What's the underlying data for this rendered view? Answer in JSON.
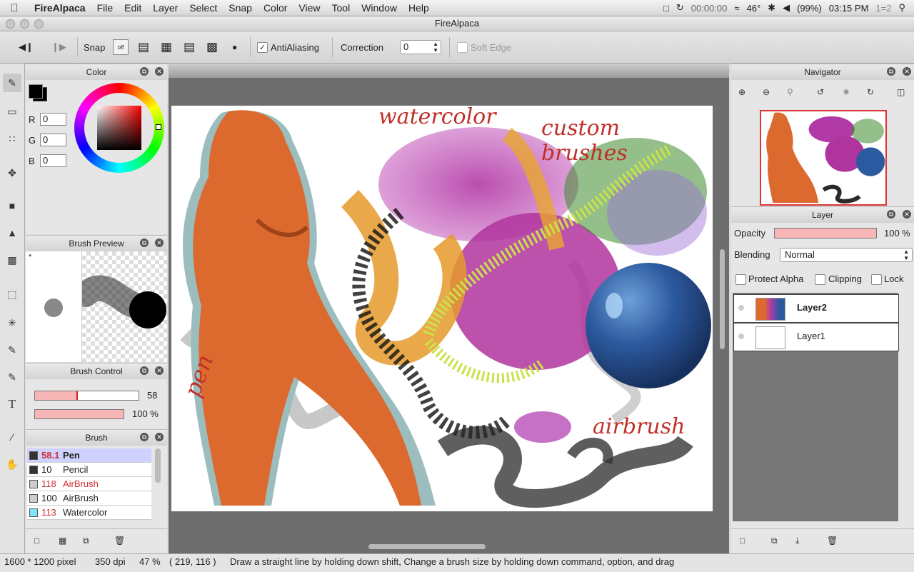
{
  "menubar": {
    "app": "FireAlpaca",
    "items": [
      "File",
      "Edit",
      "Layer",
      "Select",
      "Snap",
      "Color",
      "View",
      "Tool",
      "Window",
      "Help"
    ],
    "timer": "00:00:00",
    "temperature": "46°",
    "battery": "(99%)",
    "clock": "03:15 PM",
    "extra": "1=2"
  },
  "window": {
    "title": "FireAlpaca"
  },
  "toolbar": {
    "snap_label": "Snap",
    "snap_off": "off",
    "antialiasing_label": "AntiAliasing",
    "antialiasing_checked": true,
    "correction_label": "Correction",
    "correction_value": "0",
    "soft_edge_label": "Soft Edge"
  },
  "color_panel": {
    "title": "Color",
    "r_label": "R",
    "r": "0",
    "g_label": "G",
    "g": "0",
    "b_label": "B",
    "b": "0",
    "current_color": "#000000"
  },
  "brush_preview": {
    "title": "Brush Preview",
    "marker": "*"
  },
  "brush_control": {
    "title": "Brush Control",
    "size": "58",
    "opacity": "100 %",
    "size_fraction": 0.4,
    "opacity_fraction": 1.0
  },
  "brush_panel": {
    "title": "Brush",
    "items": [
      {
        "size": "58.1",
        "name": "Pen",
        "color": "#333333",
        "selected": true
      },
      {
        "size": "10",
        "name": "Pencil",
        "color": "#333333",
        "selected": false
      },
      {
        "size": "118",
        "name": "AirBrush",
        "color": "#cccccc",
        "selected": false
      },
      {
        "size": "100",
        "name": "AirBrush",
        "color": "#cccccc",
        "selected": false
      },
      {
        "size": "113",
        "name": "Watercolor",
        "color": "#7fe3ff",
        "selected": false
      }
    ]
  },
  "canvas": {
    "labels": {
      "watercolor": "watercolor",
      "custom": "custom brushes",
      "pen": "pen",
      "airbrush": "airbrush"
    }
  },
  "navigator": {
    "title": "Navigator"
  },
  "layer_panel": {
    "title": "Layer",
    "opacity_label": "Opacity",
    "opacity": "100 %",
    "blending_label": "Blending",
    "blending": "Normal",
    "protect_alpha": "Protect Alpha",
    "clipping": "Clipping",
    "lock": "Lock",
    "layers": [
      {
        "name": "Layer2",
        "selected": true
      },
      {
        "name": "Layer1",
        "selected": false
      }
    ]
  },
  "status": {
    "size": "1600 * 1200 pixel",
    "dpi": "350 dpi",
    "zoom": "47 %",
    "coords": "( 219, 116 )",
    "hint": "Draw a straight line by holding down shift, Change a brush size by holding down command, option, and drag"
  }
}
